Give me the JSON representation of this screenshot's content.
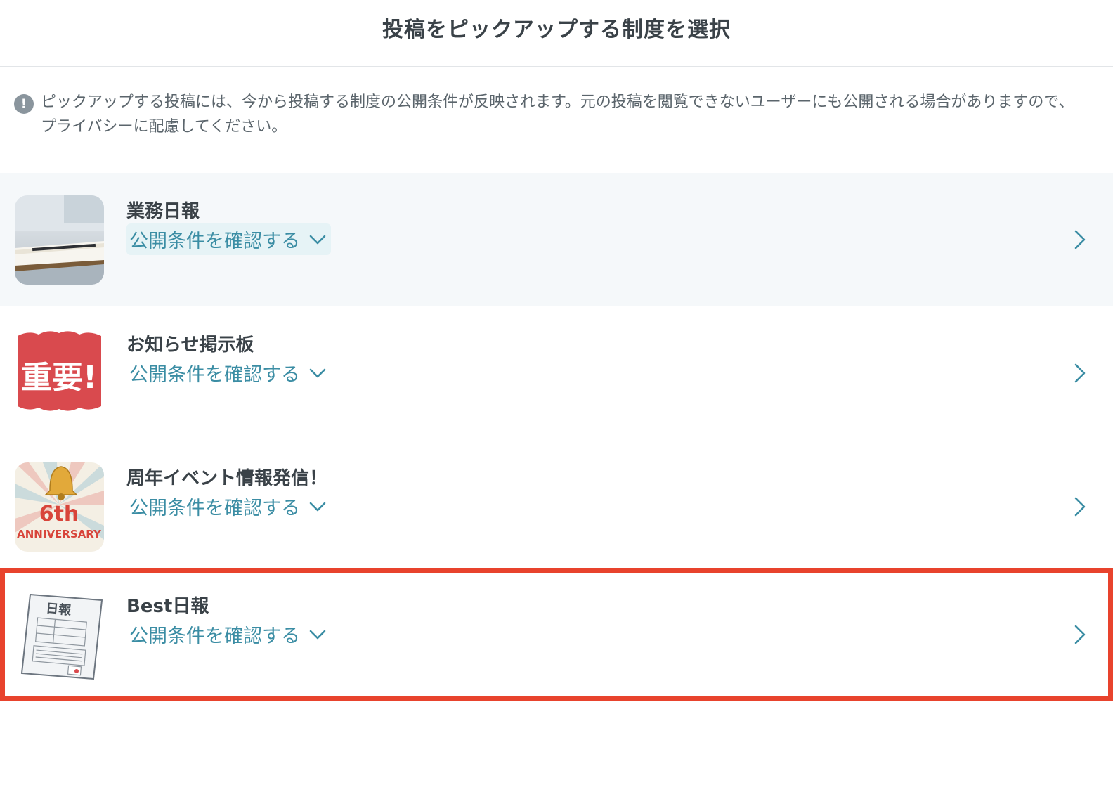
{
  "header": {
    "title": "投稿をピックアップする制度を選択"
  },
  "notice": {
    "icon": "exclamation-icon",
    "text": "ピックアップする投稿には、今から投稿する制度の公開条件が反映されます。元の投稿を閲覧できないユーザーにも公開される場合がありますので、プライバシーに配慮してください。"
  },
  "programs": [
    {
      "title": "業務日報",
      "conditions_label": "公開条件を確認する",
      "thumbnail": "notebook-pen-photo"
    },
    {
      "title": "お知らせ掲示板",
      "conditions_label": "公開条件を確認する",
      "thumbnail": "juyo-stamp",
      "thumbnail_text": "重要!"
    },
    {
      "title": "周年イベント情報発信！",
      "conditions_label": "公開条件を確認する",
      "thumbnail": "anniversary-bell",
      "thumbnail_text": "6th",
      "thumbnail_subtext": "ANNIVERSARY"
    },
    {
      "title": "Best日報",
      "conditions_label": "公開条件を確認する",
      "thumbnail": "daily-report-sheet",
      "thumbnail_text": "日報"
    }
  ],
  "colors": {
    "accent": "#3b8da4",
    "highlight_border": "#e8432d",
    "active_row_bg": "#f5f8fa"
  }
}
